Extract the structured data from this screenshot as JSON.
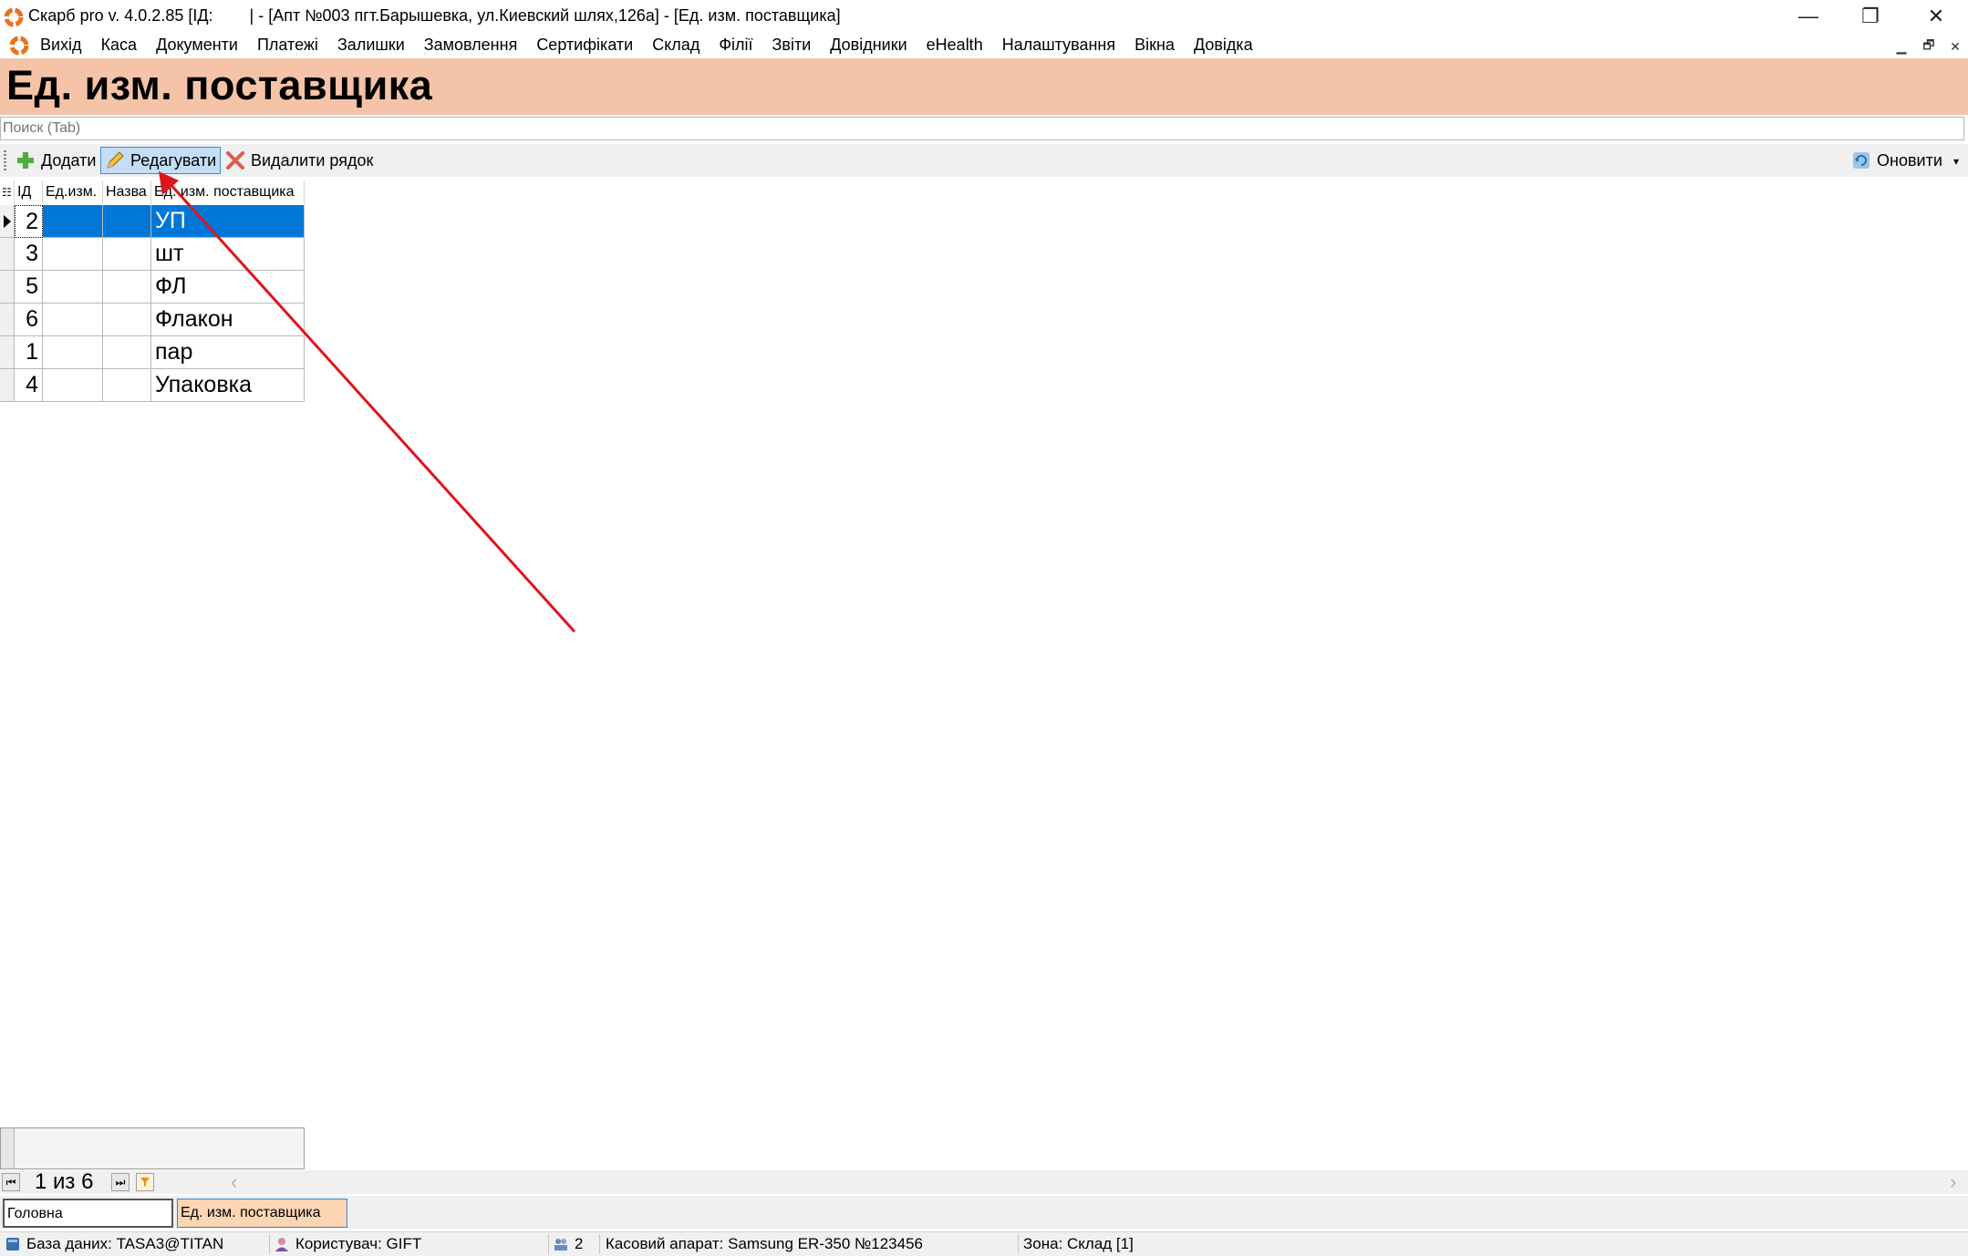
{
  "window": {
    "title": "Скарб pro v. 4.0.2.85 [ІД:        | - [Апт №003 пгт.Барышевка, ул.Киевский шлях,126а] - [Ед. изм. поставщика]",
    "minimize": "—",
    "restore": "❐",
    "close": "✕"
  },
  "menu": {
    "items": [
      "Вихід",
      "Каса",
      "Документи",
      "Платежі",
      "Залишки",
      "Замовлення",
      "Сертифікати",
      "Склад",
      "Філії",
      "Звіти",
      "Довідники",
      "eHealth",
      "Налаштування",
      "Вікна",
      "Довідка"
    ],
    "mdi_minimize": "▁",
    "mdi_restore": "🗗",
    "mdi_close": "✕"
  },
  "page": {
    "title": "Ед. изм. поставщика",
    "header_color": "#f5c3a7"
  },
  "search": {
    "placeholder": "Поиск (Tab)",
    "value": ""
  },
  "toolbar": {
    "add_label": "Додати",
    "edit_label": "Редагувати",
    "delete_label": "Видалити рядок",
    "refresh_label": "Оновити"
  },
  "grid": {
    "columns": [
      "ІД",
      "Ед.изм.",
      "Назва",
      "Ед. изм. поставщика"
    ],
    "rows": [
      {
        "id": "2",
        "unit": "",
        "name": "",
        "supplier_unit": "УП"
      },
      {
        "id": "3",
        "unit": "",
        "name": "",
        "supplier_unit": "шт"
      },
      {
        "id": "5",
        "unit": "",
        "name": "",
        "supplier_unit": "ФЛ"
      },
      {
        "id": "6",
        "unit": "",
        "name": "",
        "supplier_unit": "Флакон"
      },
      {
        "id": "1",
        "unit": "",
        "name": "",
        "supplier_unit": "пар"
      },
      {
        "id": "4",
        "unit": "",
        "name": "",
        "supplier_unit": "Упаковка"
      }
    ],
    "selected_row": 0,
    "selection_color": "#0077d7"
  },
  "navigator": {
    "page_info": "1 из 6"
  },
  "tabs": {
    "home": "Головна",
    "current": "Ед. изм. поставщика"
  },
  "status": {
    "database": "База даних: TASA3@TITAN",
    "user": "Користувач: GIFT",
    "count": "2",
    "register": "Касовий апарат: Samsung ER-350 №123456",
    "zone": "Зона: Склад [1]"
  },
  "annotation": {
    "arrow_color": "#e0141b"
  }
}
